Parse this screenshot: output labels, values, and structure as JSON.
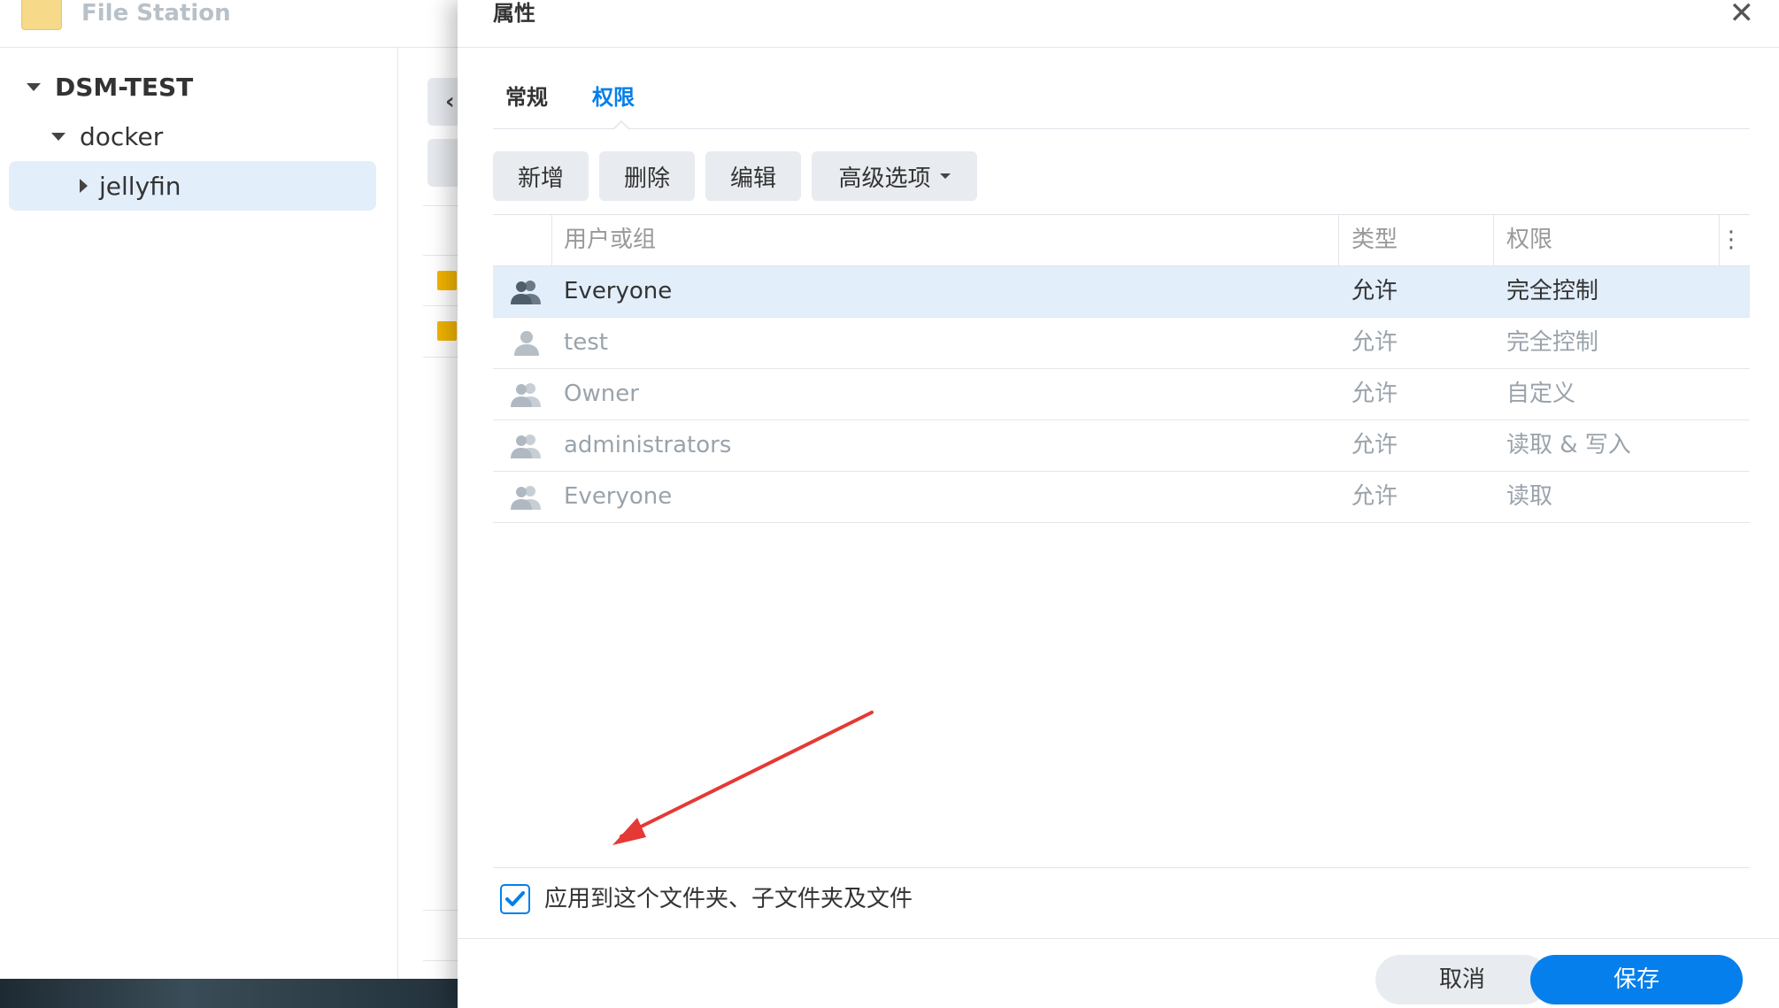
{
  "app": {
    "title": "File Station",
    "logo_icon": "folder-app-icon"
  },
  "tree": {
    "root": "DSM-TEST",
    "folder": "docker",
    "subfolder": "jellyfin"
  },
  "dialog": {
    "title": "属性",
    "close_icon": "close-icon",
    "tabs": [
      {
        "label": "常规",
        "active": false
      },
      {
        "label": "权限",
        "active": true
      }
    ],
    "toolbar": {
      "add": "新增",
      "delete": "删除",
      "edit": "编辑",
      "advanced": "高级选项"
    },
    "columns": {
      "user": "用户或组",
      "type": "类型",
      "permission": "权限"
    },
    "rows": [
      {
        "icon": "group-icon",
        "name": "Everyone",
        "type": "允许",
        "permission": "完全控制",
        "selected": true
      },
      {
        "icon": "user-icon",
        "name": "test",
        "type": "允许",
        "permission": "完全控制",
        "selected": false
      },
      {
        "icon": "group-icon",
        "name": "Owner",
        "type": "允许",
        "permission": "自定义",
        "selected": false
      },
      {
        "icon": "group-icon",
        "name": "administrators",
        "type": "允许",
        "permission": "读取 & 写入",
        "selected": false
      },
      {
        "icon": "group-icon",
        "name": "Everyone",
        "type": "允许",
        "permission": "读取",
        "selected": false
      }
    ],
    "apply_checkbox": {
      "label": "应用到这个文件夹、子文件夹及文件",
      "checked": true
    },
    "buttons": {
      "cancel": "取消",
      "save": "保存"
    }
  },
  "colors": {
    "accent": "#057feb",
    "selected_row": "#e3eefb",
    "annotation_arrow": "#e53935"
  }
}
